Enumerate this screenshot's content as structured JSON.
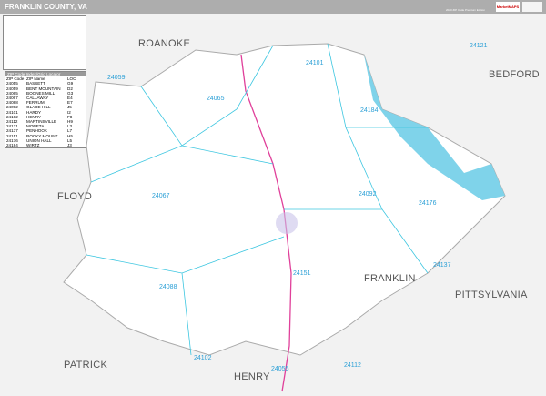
{
  "header": {
    "title": "FRANKLIN COUNTY, VA",
    "edition": "2020 ZIP Code Premium Edition",
    "logo": "MarketMAPS"
  },
  "index": {
    "title": "ZIP Code Index/Grid Locator",
    "columns": [
      "ZIP Code",
      "ZIP Name",
      "LOC"
    ],
    "rows": [
      [
        "24055",
        "BASSETT",
        "G9"
      ],
      [
        "24059",
        "BENT MOUNTAIN",
        "D2"
      ],
      [
        "24065",
        "BOONES MILL",
        "G3"
      ],
      [
        "24067",
        "CALLAWAY",
        "E4"
      ],
      [
        "24088",
        "FERRUM",
        "E7"
      ],
      [
        "24092",
        "GLADE HILL",
        "J5"
      ],
      [
        "24101",
        "HARDY",
        "I2"
      ],
      [
        "24102",
        "HENRY",
        "F8"
      ],
      [
        "24112",
        "MARTINSVILLE",
        "H9"
      ],
      [
        "24121",
        "MONETA",
        "L3"
      ],
      [
        "24137",
        "PENHOOK",
        "L7"
      ],
      [
        "24151",
        "ROCKY MOUNT",
        "H5"
      ],
      [
        "24176",
        "UNION HALL",
        "L5"
      ],
      [
        "24184",
        "WIRTZ",
        "J3"
      ]
    ]
  },
  "places": {
    "roanoke": "ROANOKE",
    "bedford": "BEDFORD",
    "floyd": "FLOYD",
    "franklin": "FRANKLIN",
    "pittsylvania": "PITTSYLVANIA",
    "patrick": "PATRICK",
    "henry": "HENRY"
  },
  "zips": [
    {
      "t": "24059",
      "c": "z1"
    },
    {
      "t": "24065",
      "c": "z2"
    },
    {
      "t": "24101",
      "c": "z3"
    },
    {
      "t": "24121",
      "c": "z4"
    },
    {
      "t": "24184",
      "c": "z5"
    },
    {
      "t": "24067",
      "c": "z6"
    },
    {
      "t": "24092",
      "c": "z7"
    },
    {
      "t": "24176",
      "c": "z8"
    },
    {
      "t": "24151",
      "c": "z9"
    },
    {
      "t": "24137",
      "c": "z10"
    },
    {
      "t": "24088",
      "c": "z11"
    },
    {
      "t": "24102",
      "c": "z12"
    },
    {
      "t": "24055",
      "c": "z13"
    },
    {
      "t": "24112",
      "c": "z14"
    }
  ],
  "colors": {
    "header": "#adadad",
    "water": "#7fd3ea",
    "zipline": "#3cc6e0",
    "highway": "#e0409a"
  }
}
